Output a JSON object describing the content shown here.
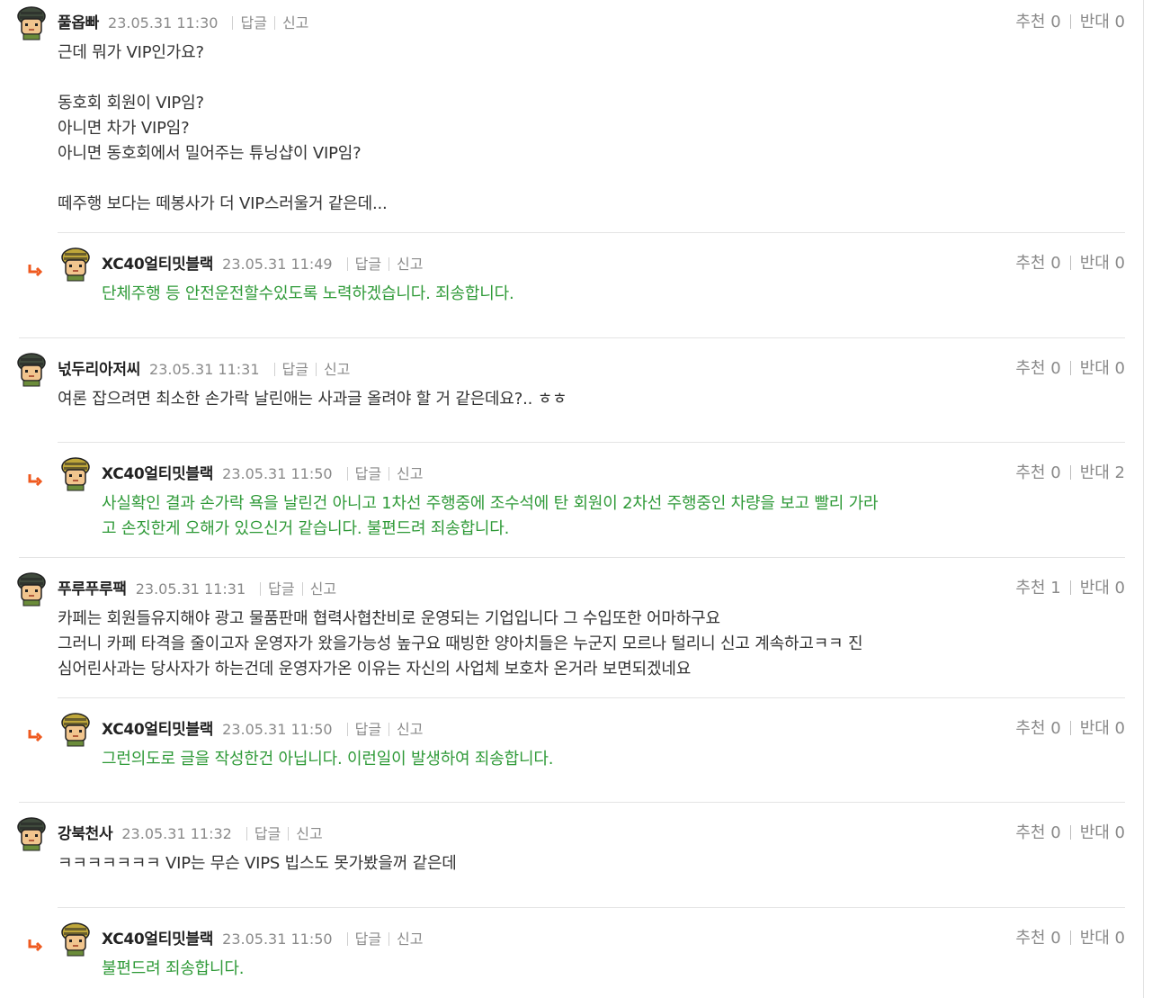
{
  "comments": [
    {
      "type": "top",
      "nickname": "풀옵빠",
      "datetime": "23.05.31 11:30",
      "reply_label": "답글",
      "report_label": "신고",
      "up_label": "추천",
      "up_count": "0",
      "down_label": "반대",
      "down_count": "0",
      "text": "근데 뭐가 VIP인가요?\n\n동호회 회원이 VIP임?\n아니면 차가 VIP임?\n아니면 동호회에서 밀어주는 튜닝샵이 VIP임?\n\n떼주행 보다는 떼봉사가 더 VIP스러울거 같은데..."
    },
    {
      "type": "reply",
      "nickname": "XC40얼티밋블랙",
      "datetime": "23.05.31 11:49",
      "reply_label": "답글",
      "report_label": "신고",
      "up_label": "추천",
      "up_count": "0",
      "down_label": "반대",
      "down_count": "0",
      "text": "단체주행 등 안전운전할수있도록 노력하겠습니다. 죄송합니다."
    },
    {
      "type": "top",
      "nickname": "넋두리아저씨",
      "datetime": "23.05.31 11:31",
      "reply_label": "답글",
      "report_label": "신고",
      "up_label": "추천",
      "up_count": "0",
      "down_label": "반대",
      "down_count": "0",
      "text": "여론 잡으려면 최소한 손가락 날린애는 사과글 올려야 할 거 같은데요?.. ㅎㅎ"
    },
    {
      "type": "reply",
      "nickname": "XC40얼티밋블랙",
      "datetime": "23.05.31 11:50",
      "reply_label": "답글",
      "report_label": "신고",
      "up_label": "추천",
      "up_count": "0",
      "down_label": "반대",
      "down_count": "2",
      "text": "사실확인 결과 손가락 욕을 날린건 아니고 1차선 주행중에 조수석에 탄 회원이 2차선 주행중인 차량을 보고 빨리 가라\n고 손짓한게 오해가 있으신거 같습니다. 불편드려 죄송합니다."
    },
    {
      "type": "top",
      "nickname": "푸루푸루팩",
      "datetime": "23.05.31 11:31",
      "reply_label": "답글",
      "report_label": "신고",
      "up_label": "추천",
      "up_count": "1",
      "down_label": "반대",
      "down_count": "0",
      "text": "카페는 회원들유지해야 광고 물품판매 협력사협찬비로 운영되는 기업입니다 그 수입또한 어마하구요\n그러니 카페 타격을 줄이고자 운영자가 왔을가능성 높구요 때빙한 양아치들은 누군지 모르나 털리니 신고 계속하고ㅋㅋ 진\n심어린사과는 당사자가 하는건데 운영자가온 이유는 자신의 사업체 보호차 온거라 보면되겠네요"
    },
    {
      "type": "reply",
      "nickname": "XC40얼티밋블랙",
      "datetime": "23.05.31 11:50",
      "reply_label": "답글",
      "report_label": "신고",
      "up_label": "추천",
      "up_count": "0",
      "down_label": "반대",
      "down_count": "0",
      "text": "그런의도로 글을 작성한건 아닙니다. 이런일이 발생하여 죄송합니다."
    },
    {
      "type": "top",
      "nickname": "강북천사",
      "datetime": "23.05.31 11:32",
      "reply_label": "답글",
      "report_label": "신고",
      "up_label": "추천",
      "up_count": "0",
      "down_label": "반대",
      "down_count": "0",
      "text": "ㅋㅋㅋㅋㅋㅋㅋ VIP는 무슨 VIPS 빕스도 못가봤을꺼 같은데"
    },
    {
      "type": "reply",
      "nickname": "XC40얼티밋블랙",
      "datetime": "23.05.31 11:50",
      "reply_label": "답글",
      "report_label": "신고",
      "up_label": "추천",
      "up_count": "0",
      "down_label": "반대",
      "down_count": "0",
      "text": "불편드려 죄송합니다."
    }
  ],
  "colors": {
    "reply_text": "#2f9a38",
    "reply_arrow": "#ef5a1f",
    "meta_gray": "#8a8a8a"
  }
}
